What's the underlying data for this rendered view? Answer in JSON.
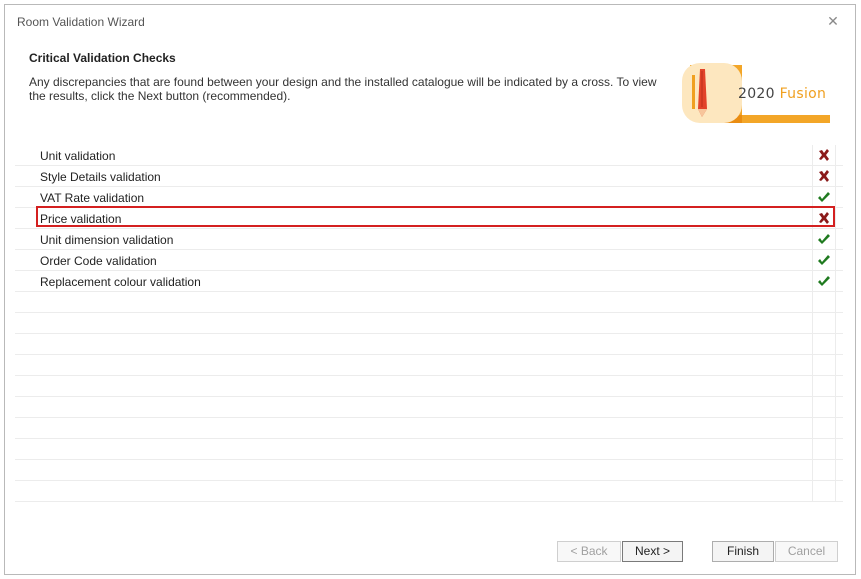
{
  "window": {
    "title": "Room Validation Wizard"
  },
  "header": {
    "title": "Critical Validation Checks",
    "description": "Any discrepancies that are found between your design and the installed catalogue will be indicated by a cross. To view the results, click the Next button (recommended).",
    "logo_text_main": "2020",
    "logo_text_accent": " Fusion"
  },
  "checks": [
    {
      "label": "Unit validation",
      "status": "fail",
      "status_icon": "cross-icon"
    },
    {
      "label": "Style Details validation",
      "status": "fail",
      "status_icon": "cross-icon"
    },
    {
      "label": "VAT Rate validation",
      "status": "pass",
      "status_icon": "check-icon"
    },
    {
      "label": "Price validation",
      "status": "fail",
      "status_icon": "cross-icon",
      "highlighted": true
    },
    {
      "label": "Unit dimension validation",
      "status": "pass",
      "status_icon": "check-icon"
    },
    {
      "label": "Order Code validation",
      "status": "pass",
      "status_icon": "check-icon"
    },
    {
      "label": "Replacement colour validation",
      "status": "pass",
      "status_icon": "check-icon"
    }
  ],
  "empty_rows": 10,
  "buttons": {
    "back_label": "< Back",
    "next_label": "Next >",
    "finish_label": "Finish",
    "cancel_label": "Cancel"
  },
  "colors": {
    "fail": "#8b1a1a",
    "pass": "#1f7a1f",
    "highlight": "#d42020",
    "brand_orange": "#f0a020"
  }
}
